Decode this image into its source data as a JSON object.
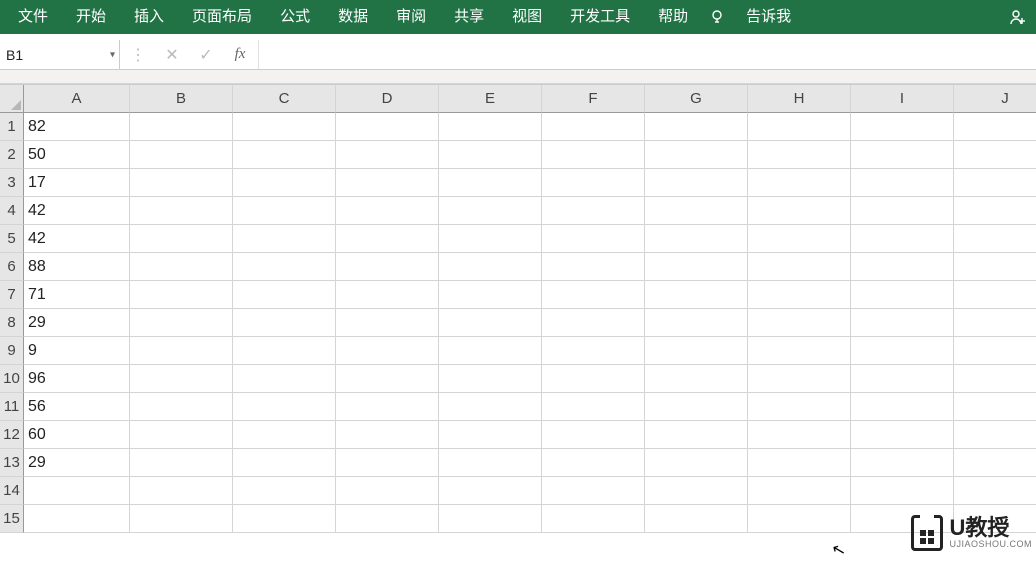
{
  "ribbon": {
    "tabs": [
      "文件",
      "开始",
      "插入",
      "页面布局",
      "公式",
      "数据",
      "审阅",
      "共享",
      "视图",
      "开发工具",
      "帮助"
    ],
    "tell_me": "告诉我"
  },
  "formula_bar": {
    "name_box": "B1",
    "fx_label": "fx",
    "formula_value": ""
  },
  "grid": {
    "columns": [
      "A",
      "B",
      "C",
      "D",
      "E",
      "F",
      "G",
      "H",
      "I",
      "J"
    ],
    "row_count": 15,
    "cells": {
      "A1": "82",
      "A2": "50",
      "A3": "17",
      "A4": "42",
      "A5": "42",
      "A6": "88",
      "A7": "71",
      "A8": "29",
      "A9": "9",
      "A10": "96",
      "A11": "56",
      "A12": "60",
      "A13": "29"
    }
  },
  "watermark": {
    "title": "U教授",
    "subtitle": "UJIAOSHOU.COM"
  }
}
